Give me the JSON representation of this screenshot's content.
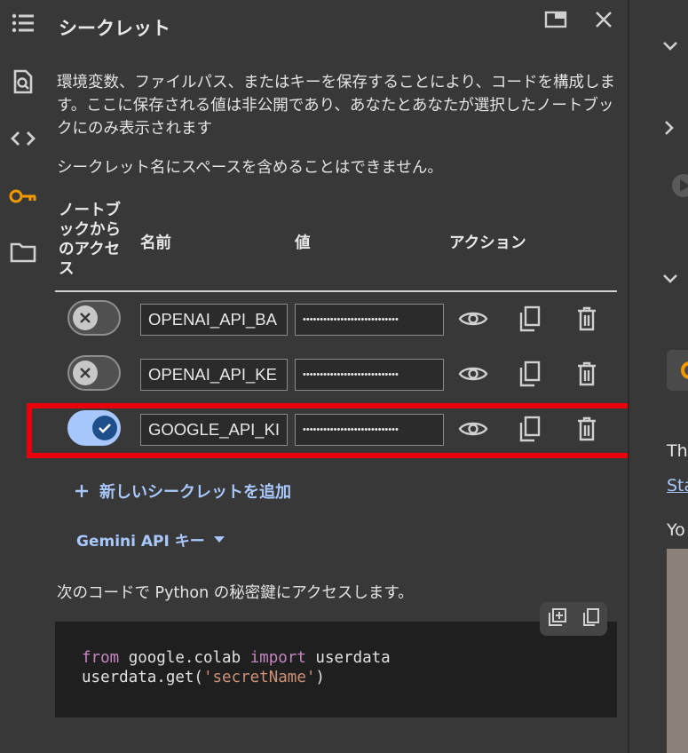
{
  "panel": {
    "title": "シークレット",
    "description": "環境変数、ファイルパス、またはキーを保存することにより、コードを構成します。ここに保存される値は非公開であり、あなたとあなたが選択したノートブックにのみ表示されます",
    "note": "シークレット名にスペースを含めることはできません。"
  },
  "table": {
    "headers": {
      "access": "ノートブックからのアクセス",
      "name": "名前",
      "value": "値",
      "actions": "アクション"
    },
    "rows": [
      {
        "name": "OPENAI_API_BA",
        "value": "••••••••••••••••••••••••••••",
        "access": false
      },
      {
        "name": "OPENAI_API_KE",
        "value": "••••••••••••••••••••••••••••",
        "access": false
      },
      {
        "name": "GOOGLE_API_KI",
        "value": "••••••••••••••••••••••••••••",
        "access": true
      }
    ]
  },
  "add_secret": "新しいシークレットを追加",
  "gemini_dropdown": "Gemini API キー",
  "code": {
    "intro": "次のコードで Python の秘密鍵にアクセスします。",
    "line1_kw1": "from",
    "line1_mod": " google.colab ",
    "line1_kw2": "import",
    "line1_rest": " userdata",
    "line2_pre": "userdata.get(",
    "line2_str": "'secretName'",
    "line2_post": ")"
  },
  "right_panel": {
    "text1": "Th",
    "link": "Sta",
    "text2": "Yo"
  },
  "colors": {
    "accent": "#a8c7fa",
    "highlight": "#e8000a",
    "key_icon": "#f29900"
  }
}
